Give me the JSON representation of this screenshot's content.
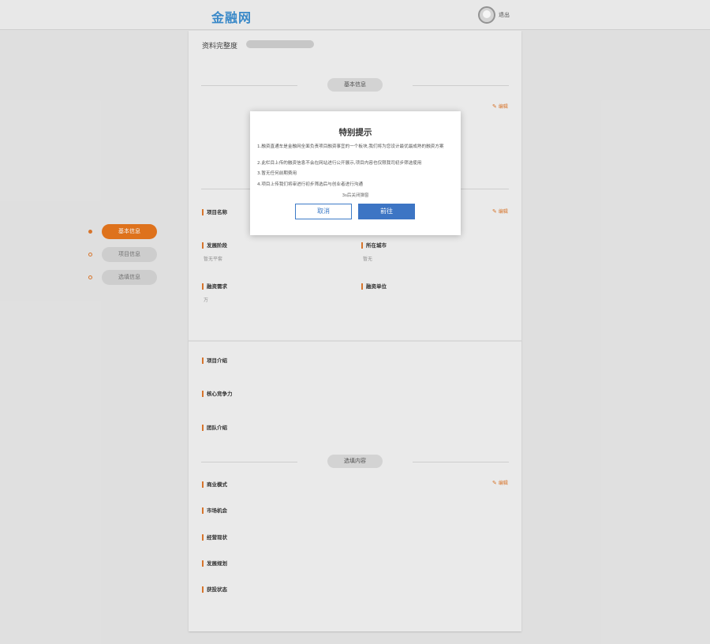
{
  "header": {
    "logo": "金融网",
    "logout": "退出"
  },
  "side_nav": [
    {
      "label": "基本信息",
      "active": true
    },
    {
      "label": "项目信息",
      "active": false
    },
    {
      "label": "选填信息",
      "active": false
    }
  ],
  "profile": {
    "completion_label": "资料完整度",
    "completion_value": ""
  },
  "sections": {
    "basic": "基本信息",
    "optional": "选填内容"
  },
  "edit_label": "编辑",
  "fields": {
    "project_name": "项目名称",
    "stage": "发展阶段",
    "stage_value": "暂无平套",
    "city": "所在城市",
    "city_value": "暂无",
    "demand": "融资需求",
    "demand_value": "万",
    "unit": "融资单位",
    "intro": "项目介绍",
    "competitiveness": "核心竞争力",
    "team": "团队介绍",
    "business_model": "商业模式",
    "market": "市场机会",
    "status": "经营现状",
    "plan": "发展规划",
    "financing_state": "获投状态"
  },
  "modal": {
    "title": "特别提示",
    "lines": [
      "1.融资直通车是金融网全面负责项目融资事宜的一个板块,我们将为您设计最优最成熟的融资方案",
      "2.此栏目上传的融资信息不会在网站进行公开展示,项目内容也仅限我司初步筛选使用",
      "3.暂无任何前期费用",
      "4.项目上传我们将审进行初步筛选后与创业者进行沟通"
    ],
    "countdown": "3s后关闭弹窗",
    "cancel": "取消",
    "confirm": "前往"
  }
}
